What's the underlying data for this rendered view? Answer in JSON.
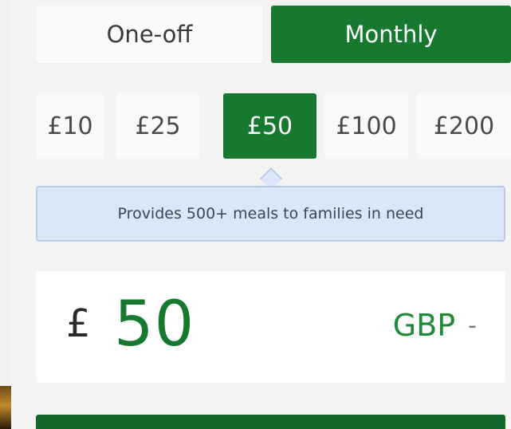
{
  "donation_frequency": {
    "options": [
      {
        "label": "One-off",
        "selected": false
      },
      {
        "label": "Monthly",
        "selected": true
      }
    ]
  },
  "amount_options": [
    {
      "label": "£10",
      "selected": false
    },
    {
      "label": "£25",
      "selected": false
    },
    {
      "label": "£50",
      "selected": true
    },
    {
      "label": "£100",
      "selected": false
    },
    {
      "label": "£200",
      "selected": false
    }
  ],
  "impact_message": "Provides 500+ meals to families in need",
  "amount_input": {
    "currency_symbol": "£",
    "value": "50",
    "currency_code": "GBP",
    "chevron": "-"
  },
  "colors": {
    "brand_green": "#17782f",
    "info_blue": "#dbe6f8",
    "page_background": "#f1f1ef"
  },
  "icons": {
    "currency_dropdown": "chevron-down-icon",
    "banner_pointer": "caret-up-icon"
  }
}
